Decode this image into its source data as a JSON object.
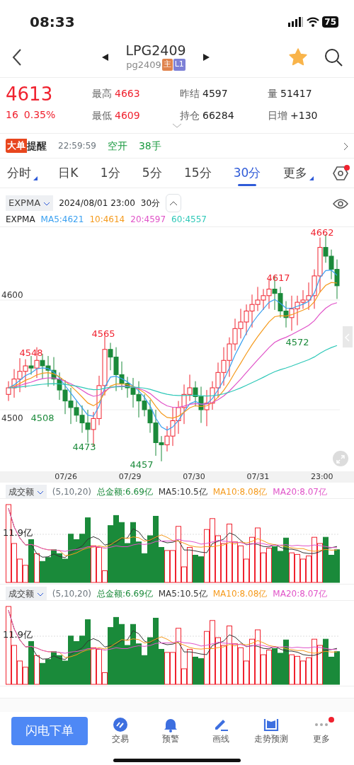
{
  "status_bar": {
    "time": "08:33",
    "battery": "75"
  },
  "header": {
    "title": "LPG2409",
    "subtitle": "pg2409",
    "badges": [
      {
        "text": "主",
        "color": "#e0834d"
      },
      {
        "text": "L1",
        "color": "#7d80d6"
      }
    ],
    "favorited": true
  },
  "quote": {
    "price": "4613",
    "change": "16",
    "change_pct": "0.35%",
    "stats": [
      {
        "label": "最高",
        "value": "4663",
        "color": "#f0222f"
      },
      {
        "label": "昨结",
        "value": "4597",
        "color": "#222222"
      },
      {
        "label": "量",
        "value": "51417",
        "color": "#222222"
      },
      {
        "label": "最低",
        "value": "4609",
        "color": "#f0222f"
      },
      {
        "label": "持仓",
        "value": "66284",
        "color": "#222222"
      },
      {
        "label": "日增",
        "value": "+130",
        "color": "#222222"
      }
    ]
  },
  "alert": {
    "tag": "大单",
    "title": "提醒",
    "time": "22:59:59",
    "action": "空开",
    "volume": "38手"
  },
  "period_tabs": [
    {
      "label": "分时",
      "selected": false,
      "dropdown": true
    },
    {
      "label": "日K",
      "selected": false,
      "dropdown": false
    },
    {
      "label": "1分",
      "selected": false,
      "dropdown": false
    },
    {
      "label": "5分",
      "selected": false,
      "dropdown": false
    },
    {
      "label": "15分",
      "selected": false,
      "dropdown": false
    },
    {
      "label": "30分",
      "selected": true,
      "dropdown": false
    },
    {
      "label": "更多",
      "selected": false,
      "dropdown": true
    }
  ],
  "settings_notification": true,
  "chart": {
    "indicator": "EXPMA",
    "datetime": "2024/08/01 23:00",
    "period": "30分",
    "legend_name": "EXPMA",
    "legend": [
      {
        "text": "MA5:4621",
        "color": "#3aa0f0"
      },
      {
        "text": "10:4614",
        "color": "#f59a1c"
      },
      {
        "text": "20:4597",
        "color": "#e052c8"
      },
      {
        "text": "60:4557",
        "color": "#2ec8b8"
      }
    ],
    "axis_labels": [
      "4600",
      "4500"
    ],
    "price_marks": [
      {
        "text": "4662",
        "color": "#f0222f"
      },
      {
        "text": "4617",
        "color": "#f0222f"
      },
      {
        "text": "4565",
        "color": "#f0222f"
      },
      {
        "text": "4548",
        "color": "#f0222f"
      },
      {
        "text": "4572",
        "color": "#1a8a3a"
      },
      {
        "text": "4473",
        "color": "#1a8a3a"
      },
      {
        "text": "4457",
        "color": "#1a8a3a"
      },
      {
        "text": "4508",
        "color": "#1a8a3a"
      }
    ],
    "dates": [
      "07/26",
      "07/29",
      "07/30",
      "07/31",
      "23:00"
    ]
  },
  "volume_panels": [
    {
      "selector": "成交额",
      "params": "(5,10,20)",
      "stats": [
        {
          "text": "总金额:6.69亿",
          "color": "#1a8a3a"
        },
        {
          "text": "MA5:10.5亿",
          "color": "#333333"
        },
        {
          "text": "MA10:8.08亿",
          "color": "#f59a1c"
        },
        {
          "text": "MA20:8.07亿",
          "color": "#e052c8"
        }
      ],
      "axis_label": "11.9亿"
    },
    {
      "selector": "成交额",
      "params": "(5,10,20)",
      "stats": [
        {
          "text": "总金额:6.69亿",
          "color": "#1a8a3a"
        },
        {
          "text": "MA5:10.5亿",
          "color": "#333333"
        },
        {
          "text": "MA10:8.08亿",
          "color": "#f59a1c"
        },
        {
          "text": "MA20:8.07亿",
          "color": "#e052c8"
        }
      ],
      "axis_label": "11.9亿"
    }
  ],
  "bottom_bar": {
    "primary_button": "闪电下单",
    "actions": [
      {
        "label": "交易",
        "kind": "trade",
        "notification": false
      },
      {
        "label": "预警",
        "kind": "alert",
        "notification": false
      },
      {
        "label": "画线",
        "kind": "draw",
        "notification": false
      },
      {
        "label": "走势预测",
        "kind": "forecast",
        "notification": false
      },
      {
        "label": "更多",
        "kind": "more",
        "notification": true
      }
    ]
  }
}
